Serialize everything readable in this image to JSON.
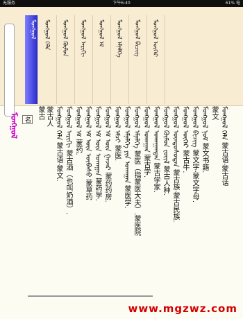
{
  "status": {
    "carrier": "无服务",
    "time": "下午6:40",
    "battery": "61% 电"
  },
  "words": [
    "ᠮᠣᠩᠭᠣᠯ",
    "ᠮᠣᠩᠭᠣᠯ ᠬᠡᠯᠡ",
    "ᠮᠣᠩᠭᠣᠯ ᠬᠦᠮᠦᠨ",
    "ᠮᠣᠩᠭᠣᠯ ᠠᠷᠢᠬᠢ",
    "ᠮᠣᠩᠭᠣᠯ ᠡᠮ",
    "ᠮᠣᠩᠭᠣᠯ ᠡᠮᠨᠡᠯᠭᠡ",
    "ᠮᠣᠩᠭᠣᠯ ᠪᠢᠴᠢᠭ",
    "ᠮᠣᠩᠭᠣᠯ ᠦᠬᠡᠷ"
  ],
  "headword": "ᠮᠣᠩᠭᠣᠯ",
  "pos": "名",
  "entries": [
    "蒙古",
    "蒙古人",
    "ᠮᠣᠩᠭᠣᠯ ᠬᠡᠯᠡ 蒙古语·蒙文.",
    "ᠮᠣᠩᠭᠣᠯ ᠠᠷᠢᠬᠢ 蒙古酒（也叫奶酒）.",
    "ᠮᠣᠩᠭᠣᠯ ᠡᠮ 蒙药.",
    "ᠮᠣᠩᠭᠣᠯ ᠡᠮ ᠦᠨ ᠦᠪᠡᠰᠦ 蒙草药",
    "ᠮᠣᠩᠭᠣᠯ ᠡᠮ ᠦᠨ ᠤᠬᠠᠭᠠᠨ 蒙药学.",
    "ᠮᠣᠩᠭᠣᠯ ᠡᠮ ᠦᠨ ᠭᠠᠵᠠᠷ 蒙药药房.",
    "ᠮᠣᠩᠭᠣᠯ ᠡᠮᠴᠢ 蒙医.",
    "ᠮᠣᠩᠭᠣᠯ ᠡᠮᠨᠡᠯᠭᠡ ᠶᠢᠨ ᠤᠬᠠᠭᠠᠨ 蒙医学.",
    "ᠮᠣᠩᠭᠣᠯ ᠡᠮᠨᠡᠯᠭᠡ 蒙医（指蒙医大夫）.蒙医院",
    "ᠮᠣᠩᠭᠣᠯ ᠤᠬᠠᠭᠠᠨ 蒙古学.",
    "ᠮᠣᠩᠭᠣᠯ ᠤᠬᠠᠭᠠᠨᠲᠠᠨ 蒙古学家.",
    "ᠮᠣᠩᠭᠣᠯ ᠬᠦᠮᠦᠨ ᠵᠦᠢᠯ 蒙古人种.",
    "ᠮᠣᠩᠭᠣᠯ ᠦᠨᠳᠦᠰᠦᠲᠡᠨ 蒙古族·蒙古民族.",
    "ᠮᠣᠩᠭᠣᠯ ᠦᠬᠡᠷ 蒙古牛.",
    "ᠮᠣᠩᠭᠣᠯ ᠪᠢᠴᠢᠭ 蒙文字·蒙文字母.",
    "ᠮᠣᠩᠭᠣᠯ ᠨᠣᠮ 蒙文书籍.",
    "蒙文",
    "ᠮᠣᠩᠭᠣᠯ ᠬᠡᠯᠡ 蒙古语·蒙古话"
  ],
  "watermark": "www.mgzwz.com"
}
